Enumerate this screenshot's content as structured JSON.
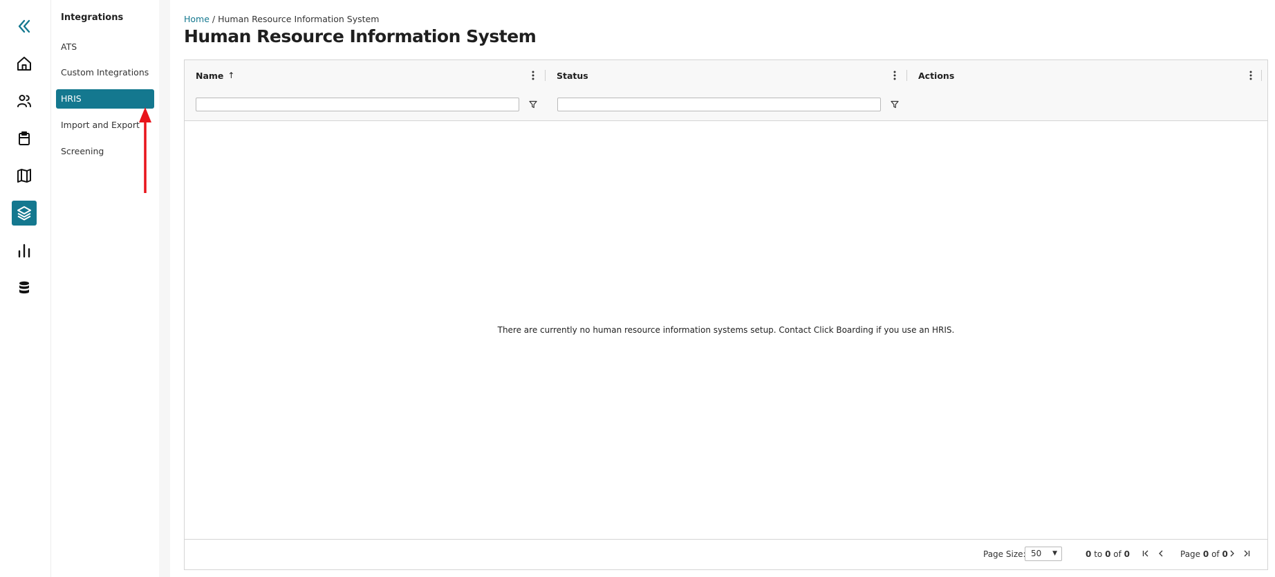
{
  "rail": {
    "items": [
      {
        "name": "collapse",
        "icon": "double-chevron-left-icon"
      },
      {
        "name": "home",
        "icon": "home-icon"
      },
      {
        "name": "people",
        "icon": "users-icon"
      },
      {
        "name": "clipboard",
        "icon": "clipboard-icon"
      },
      {
        "name": "map",
        "icon": "map-icon"
      },
      {
        "name": "integrations",
        "icon": "layers-icon",
        "active": true
      },
      {
        "name": "reports",
        "icon": "bar-chart-icon"
      },
      {
        "name": "data",
        "icon": "database-icon"
      }
    ]
  },
  "subnav": {
    "title": "Integrations",
    "items": [
      {
        "label": "ATS"
      },
      {
        "label": "Custom Integrations"
      },
      {
        "label": "HRIS",
        "active": true
      },
      {
        "label": "Import and Export"
      },
      {
        "label": "Screening"
      }
    ]
  },
  "breadcrumb": {
    "home": "Home",
    "separator": "/",
    "current": "Human Resource Information System"
  },
  "page": {
    "title": "Human Resource Information System"
  },
  "grid": {
    "columns": [
      {
        "label": "Name",
        "sort": "ascending"
      },
      {
        "label": "Status"
      },
      {
        "label": "Actions"
      }
    ],
    "filters": {
      "name": {
        "value": "",
        "placeholder": ""
      },
      "status": {
        "value": "",
        "placeholder": ""
      }
    },
    "empty_message": "There are currently no human resource information systems setup. Contact Click Boarding if you use an HRIS."
  },
  "pager": {
    "page_size_label": "Page Size:",
    "page_size": "50",
    "range_from": "0",
    "range_to_word": "to",
    "range_to": "0",
    "of_word": "of",
    "range_total": "0",
    "page_word": "Page",
    "page_current": "0",
    "page_total": "0"
  },
  "colors": {
    "accent": "#14788f",
    "annotation_arrow": "#e8141b"
  }
}
